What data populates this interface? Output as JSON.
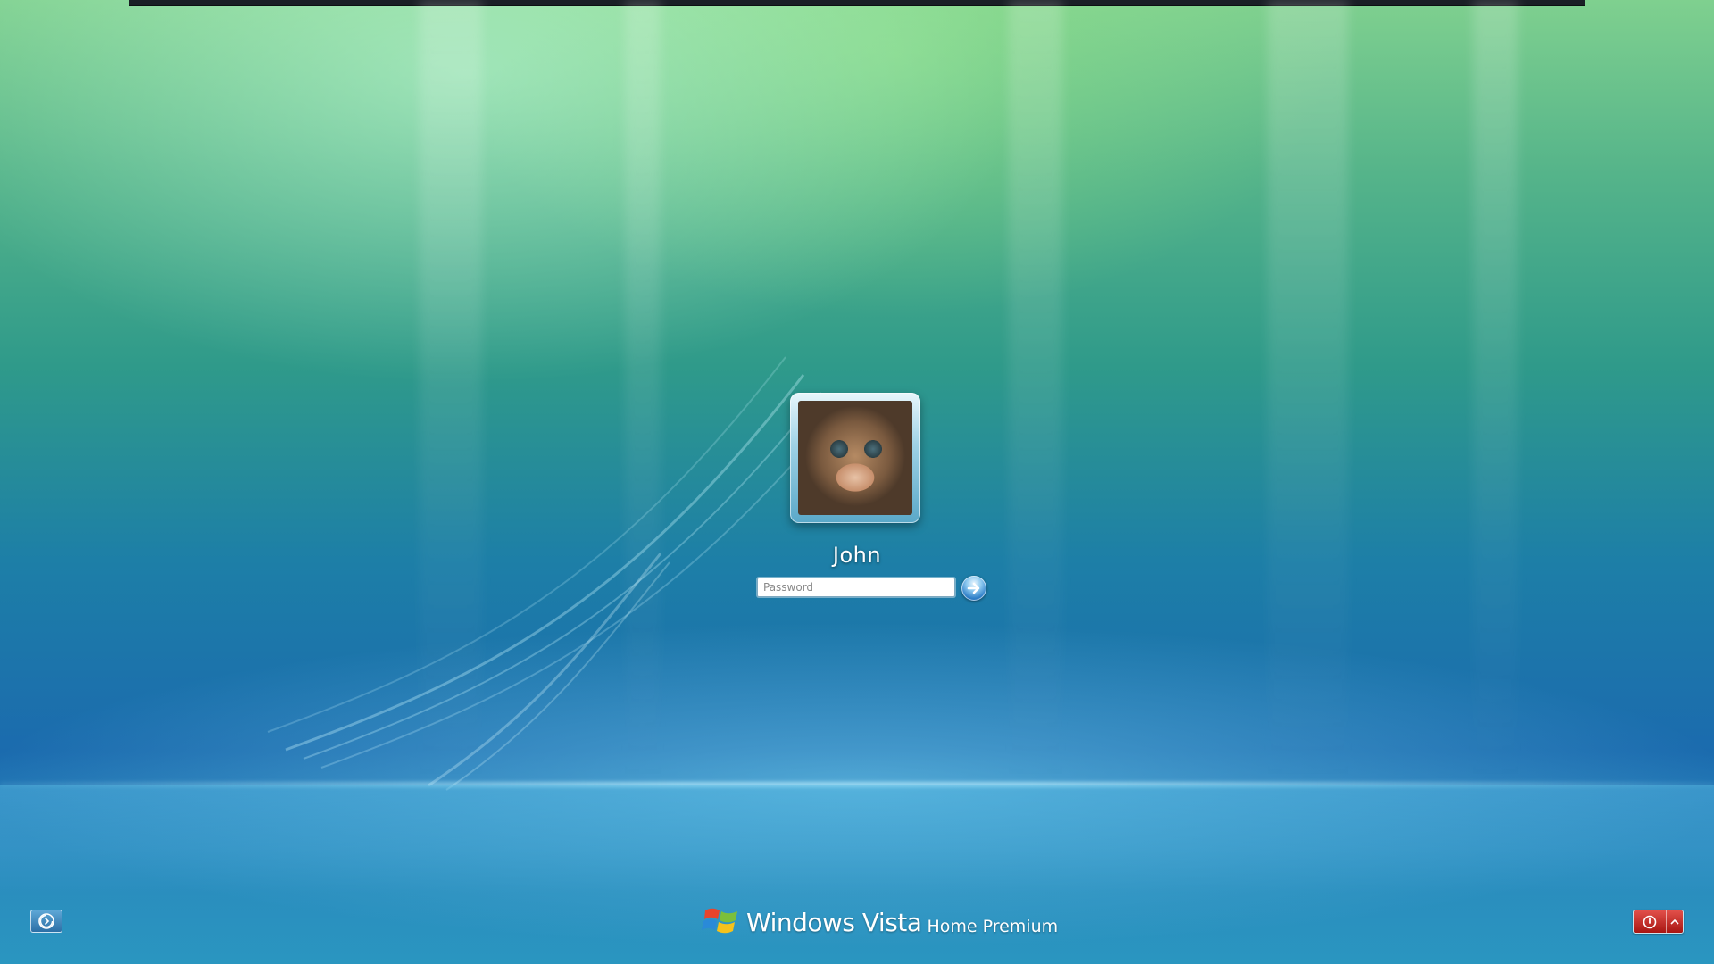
{
  "login": {
    "username": "John",
    "password_placeholder": "Password",
    "password_value": ""
  },
  "branding": {
    "product_name": "Windows Vista",
    "edition": "Home Premium"
  },
  "icons": {
    "submit": "arrow-right-icon",
    "ease_of_access": "ease-of-access-icon",
    "power": "power-icon",
    "power_options": "chevron-up-icon",
    "logo": "windows-flag-icon"
  },
  "colors": {
    "submit_accent": "#2f7fc8",
    "power_accent": "#c0241e"
  }
}
